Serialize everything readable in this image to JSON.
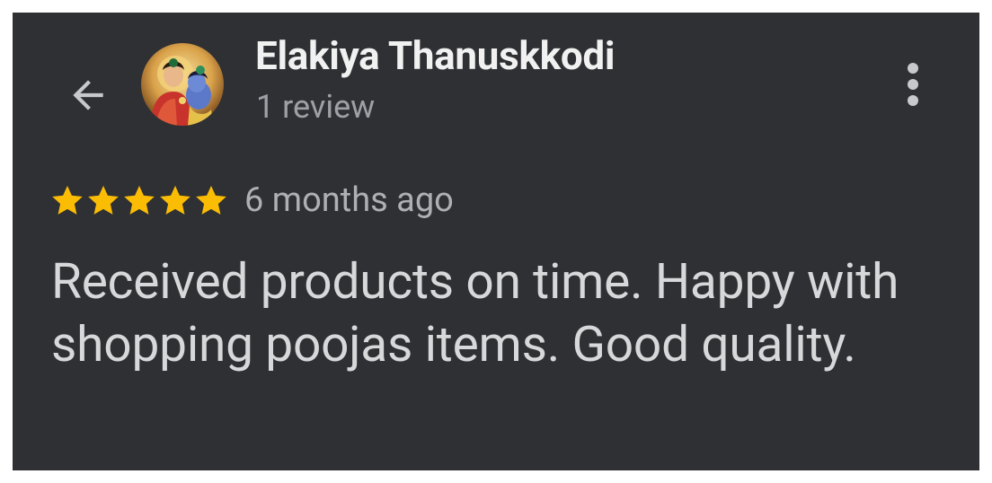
{
  "reviewer": {
    "name": "Elakiya Thanuskkodi",
    "review_count": "1 review",
    "avatar_icon": "deity-portrait-avatar"
  },
  "header": {
    "back_icon": "arrow-left-icon",
    "menu_icon": "more-vertical-icon"
  },
  "review": {
    "rating": 5,
    "rating_max": 5,
    "time_ago": "6 months ago",
    "text": "Received products on time. Happy with shopping poojas items. Good quality."
  },
  "colors": {
    "card_bg": "#2f3033",
    "star": "#fbbc04",
    "name_text": "#f1f1f2",
    "secondary_text": "#9ea0a5",
    "body_text": "#d7d8da"
  }
}
